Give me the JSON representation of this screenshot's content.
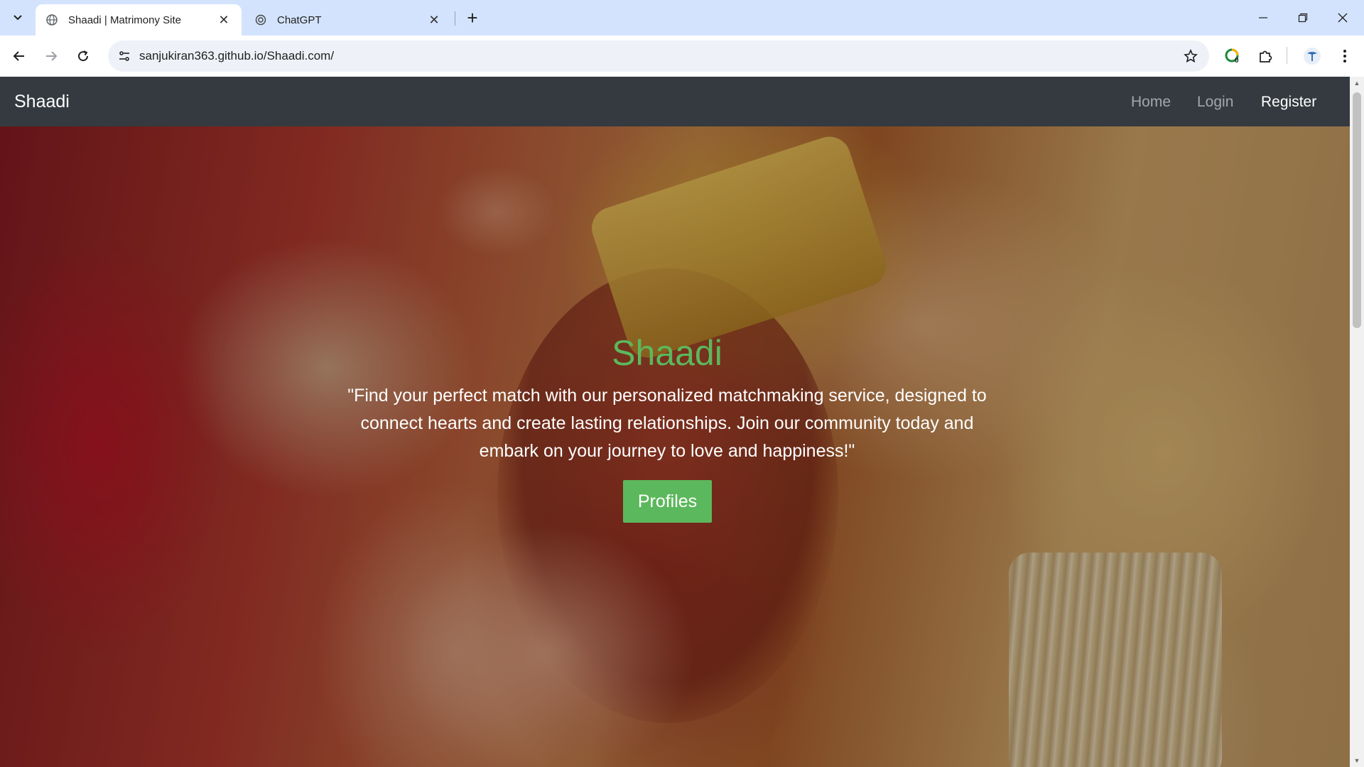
{
  "browser": {
    "tabs": [
      {
        "title": "Shaadi | Matrimony Site",
        "active": true
      },
      {
        "title": "ChatGPT",
        "active": false
      }
    ],
    "url": "sanjukiran363.github.io/Shaadi.com/",
    "extension_badge": "0"
  },
  "site": {
    "brand": "Shaadi",
    "nav": {
      "home": "Home",
      "login": "Login",
      "register": "Register"
    },
    "hero": {
      "title": "Shaadi",
      "quote": "\"Find your perfect match with our personalized matchmaking service, designed to connect hearts and create lasting relationships. Join our community today and embark on your journey to love and happiness!\"",
      "button": "Profiles"
    }
  },
  "colors": {
    "navbar_bg": "#343a40",
    "accent_green": "#5cb85c",
    "tabstrip_bg": "#d3e3fd"
  },
  "icons": [
    "tab-search-icon",
    "globe-icon",
    "chatgpt-icon",
    "close-icon",
    "plus-icon",
    "minimize-icon",
    "restore-icon",
    "back-icon",
    "forward-icon",
    "reload-icon",
    "site-info-icon",
    "star-icon",
    "extension-icon",
    "puzzle-icon",
    "profile-icon",
    "kebab-menu-icon"
  ]
}
